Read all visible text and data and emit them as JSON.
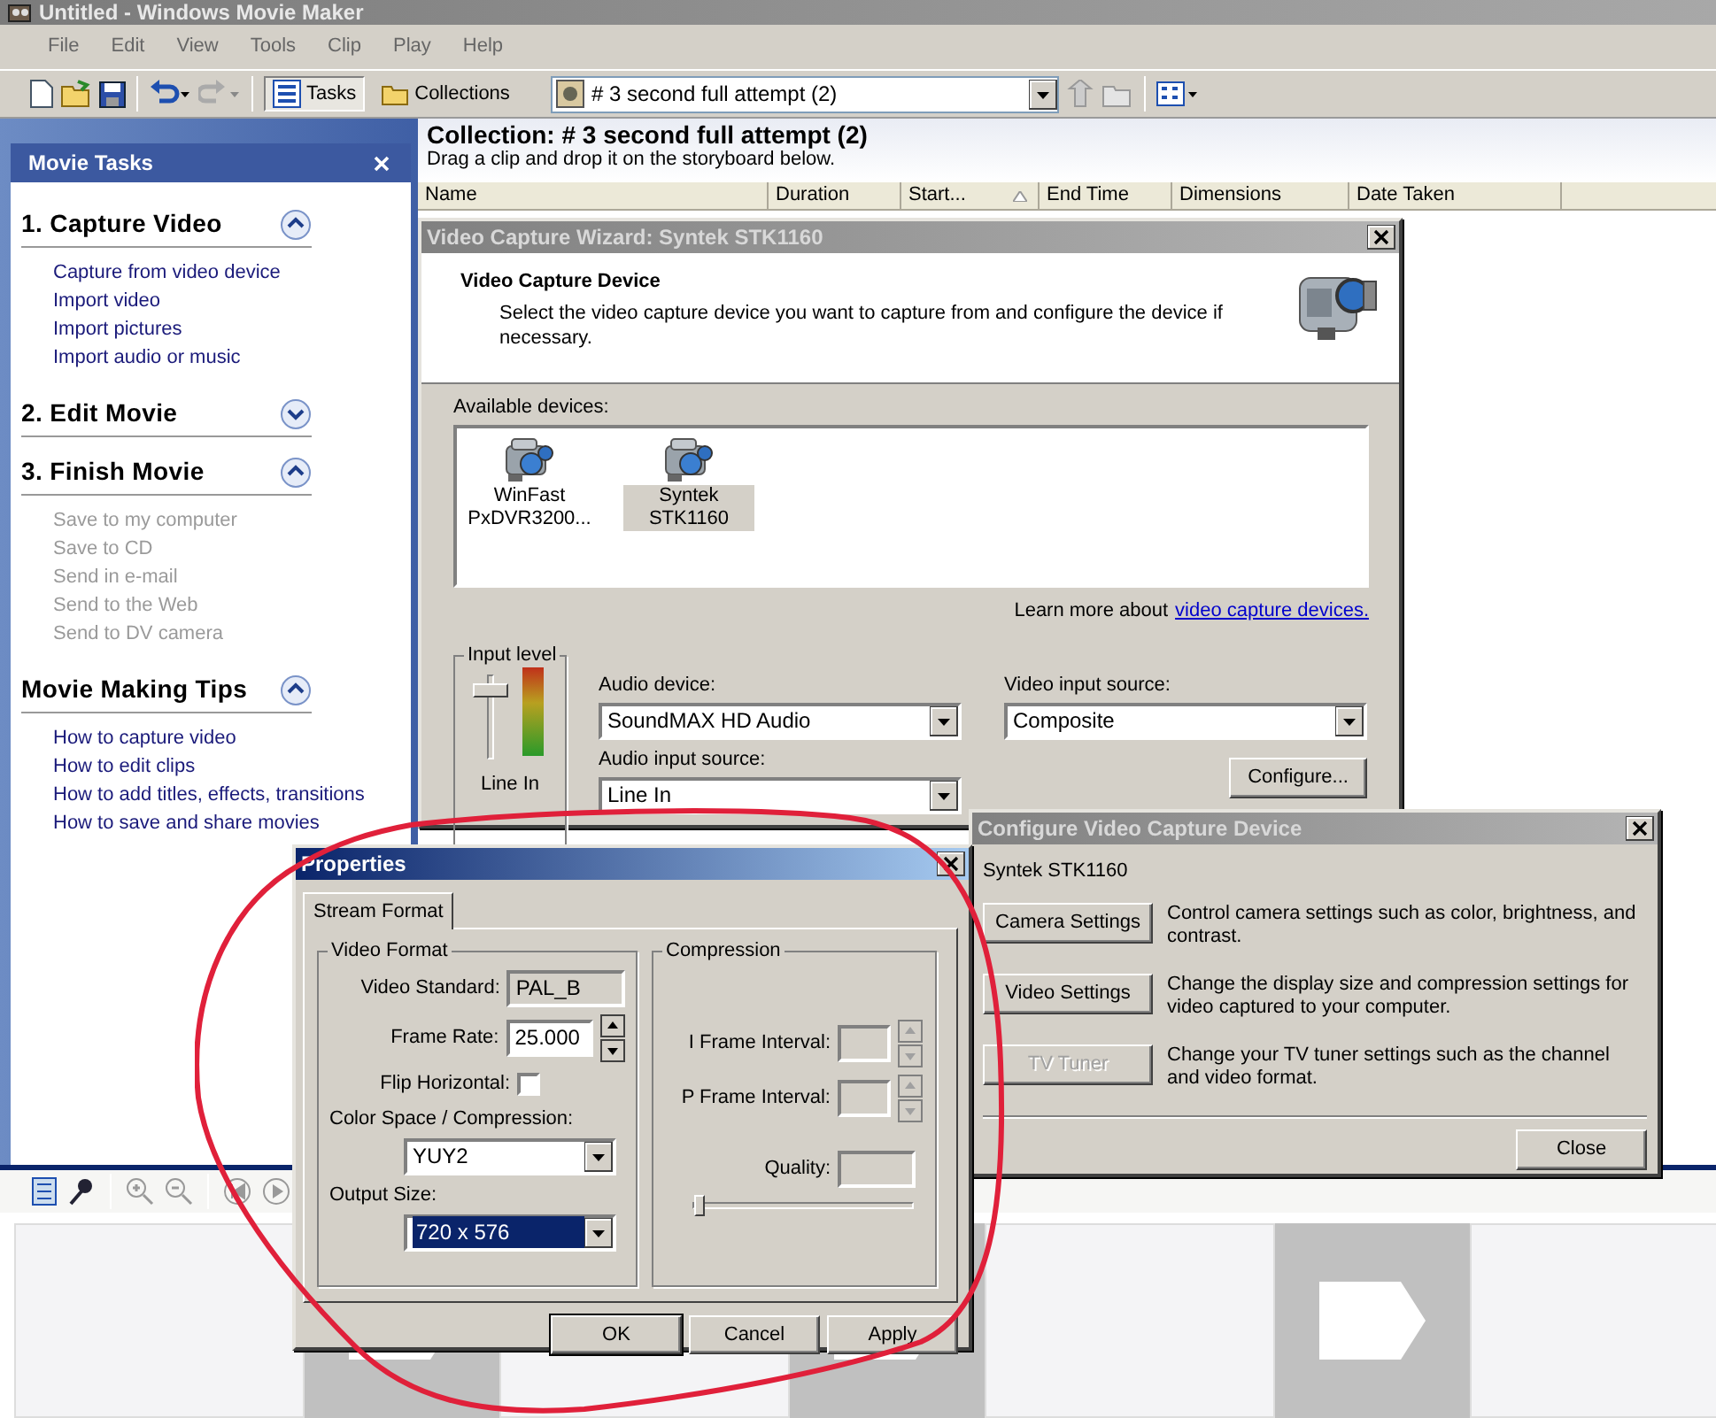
{
  "window": {
    "title": "Untitled - Windows Movie Maker"
  },
  "menu": [
    "File",
    "Edit",
    "View",
    "Tools",
    "Clip",
    "Play",
    "Help"
  ],
  "toolbar": {
    "tabs": [
      {
        "label": "Tasks",
        "kind": "tasks",
        "selected": true
      },
      {
        "label": "Collections",
        "kind": "collections",
        "selected": false
      }
    ],
    "collection_select": "# 3 second full attempt (2)"
  },
  "task_pane": {
    "title": "Movie Tasks",
    "sections": [
      {
        "title": "1. Capture Video",
        "expanded": true,
        "items": [
          {
            "label": "Capture from video device",
            "disabled": false
          },
          {
            "label": "Import video",
            "disabled": false
          },
          {
            "label": "Import pictures",
            "disabled": false
          },
          {
            "label": "Import audio or music",
            "disabled": false
          }
        ]
      },
      {
        "title": "2. Edit Movie",
        "expanded": false
      },
      {
        "title": "3. Finish Movie",
        "expanded": true,
        "items": [
          {
            "label": "Save to my computer",
            "disabled": true
          },
          {
            "label": "Save to CD",
            "disabled": true
          },
          {
            "label": "Send in e-mail",
            "disabled": true
          },
          {
            "label": "Send to the Web",
            "disabled": true
          },
          {
            "label": "Send to DV camera",
            "disabled": true
          }
        ]
      },
      {
        "title": "Movie Making Tips",
        "expanded": true,
        "items": [
          {
            "label": "How to capture video",
            "disabled": false
          },
          {
            "label": "How to edit clips",
            "disabled": false
          },
          {
            "label": "How to add titles, effects, transitions",
            "disabled": false
          },
          {
            "label": "How to save and share movies",
            "disabled": false
          }
        ]
      }
    ]
  },
  "collection": {
    "title": "Collection: # 3 second full attempt (2)",
    "hint": "Drag a clip and drop it on the storyboard below.",
    "columns": [
      {
        "label": "Name",
        "sorted": false
      },
      {
        "label": "Duration",
        "sorted": false
      },
      {
        "label": "Start...",
        "sorted": true
      },
      {
        "label": "End Time",
        "sorted": false
      },
      {
        "label": "Dimensions",
        "sorted": false
      },
      {
        "label": "Date Taken",
        "sorted": false
      }
    ]
  },
  "wizard": {
    "title": "Video Capture Wizard: Syntek STK1160",
    "heading": "Video Capture Device",
    "description": "Select the video capture device you want to capture from and configure the device if necessary.",
    "devices_label": "Available devices:",
    "devices": [
      {
        "name": "WinFast PxDVR3200...",
        "selected": false
      },
      {
        "name": "Syntek STK1160",
        "selected": true
      }
    ],
    "learn_more": "Learn more about",
    "learn_more_link": "video capture devices.",
    "input_level": {
      "legend": "Input level",
      "level": 0.9,
      "source": "Line In"
    },
    "audio_device": {
      "label": "Audio device:",
      "value": "SoundMAX HD Audio"
    },
    "audio_input_source": {
      "label": "Audio input source:",
      "value": "Line In"
    },
    "video_input_source": {
      "label": "Video input source:",
      "value": "Composite"
    },
    "configure_button": "Configure..."
  },
  "configure_dialog": {
    "title": "Configure Video Capture Device",
    "device": "Syntek STK1160",
    "options": [
      {
        "button": "Camera Settings",
        "description": "Control camera settings such as color, brightness, and contrast.",
        "disabled": false
      },
      {
        "button": "Video Settings",
        "description": "Change the display size and compression settings for video captured to your computer.",
        "disabled": false
      },
      {
        "button": "TV Tuner",
        "description": "Change your TV tuner settings such as the channel and video format.",
        "disabled": true
      }
    ],
    "close_button": "Close"
  },
  "properties": {
    "title": "Properties",
    "tabs": [
      {
        "label": "Stream Format",
        "selected": true
      }
    ],
    "video_format": {
      "legend": "Video Format",
      "video_standard": {
        "label": "Video Standard:",
        "value": "PAL_B"
      },
      "frame_rate": {
        "label": "Frame Rate:",
        "value": "25.000"
      },
      "flip_horizontal": {
        "label": "Flip Horizontal:",
        "checked": false
      },
      "color_space": {
        "label": "Color Space / Compression:",
        "value": "YUY2"
      },
      "output_size": {
        "label": "Output Size:",
        "value": "720 x 576",
        "highlighted": true
      }
    },
    "compression": {
      "legend": "Compression",
      "i_frame_interval": {
        "label": "I Frame Interval:",
        "disabled": true
      },
      "p_frame_interval": {
        "label": "P Frame Interval:",
        "disabled": true
      },
      "quality": {
        "label": "Quality:",
        "level": 0
      }
    },
    "buttons": [
      {
        "label": "OK",
        "default": true
      },
      {
        "label": "Cancel",
        "default": false
      },
      {
        "label": "Apply",
        "default": false
      }
    ]
  }
}
